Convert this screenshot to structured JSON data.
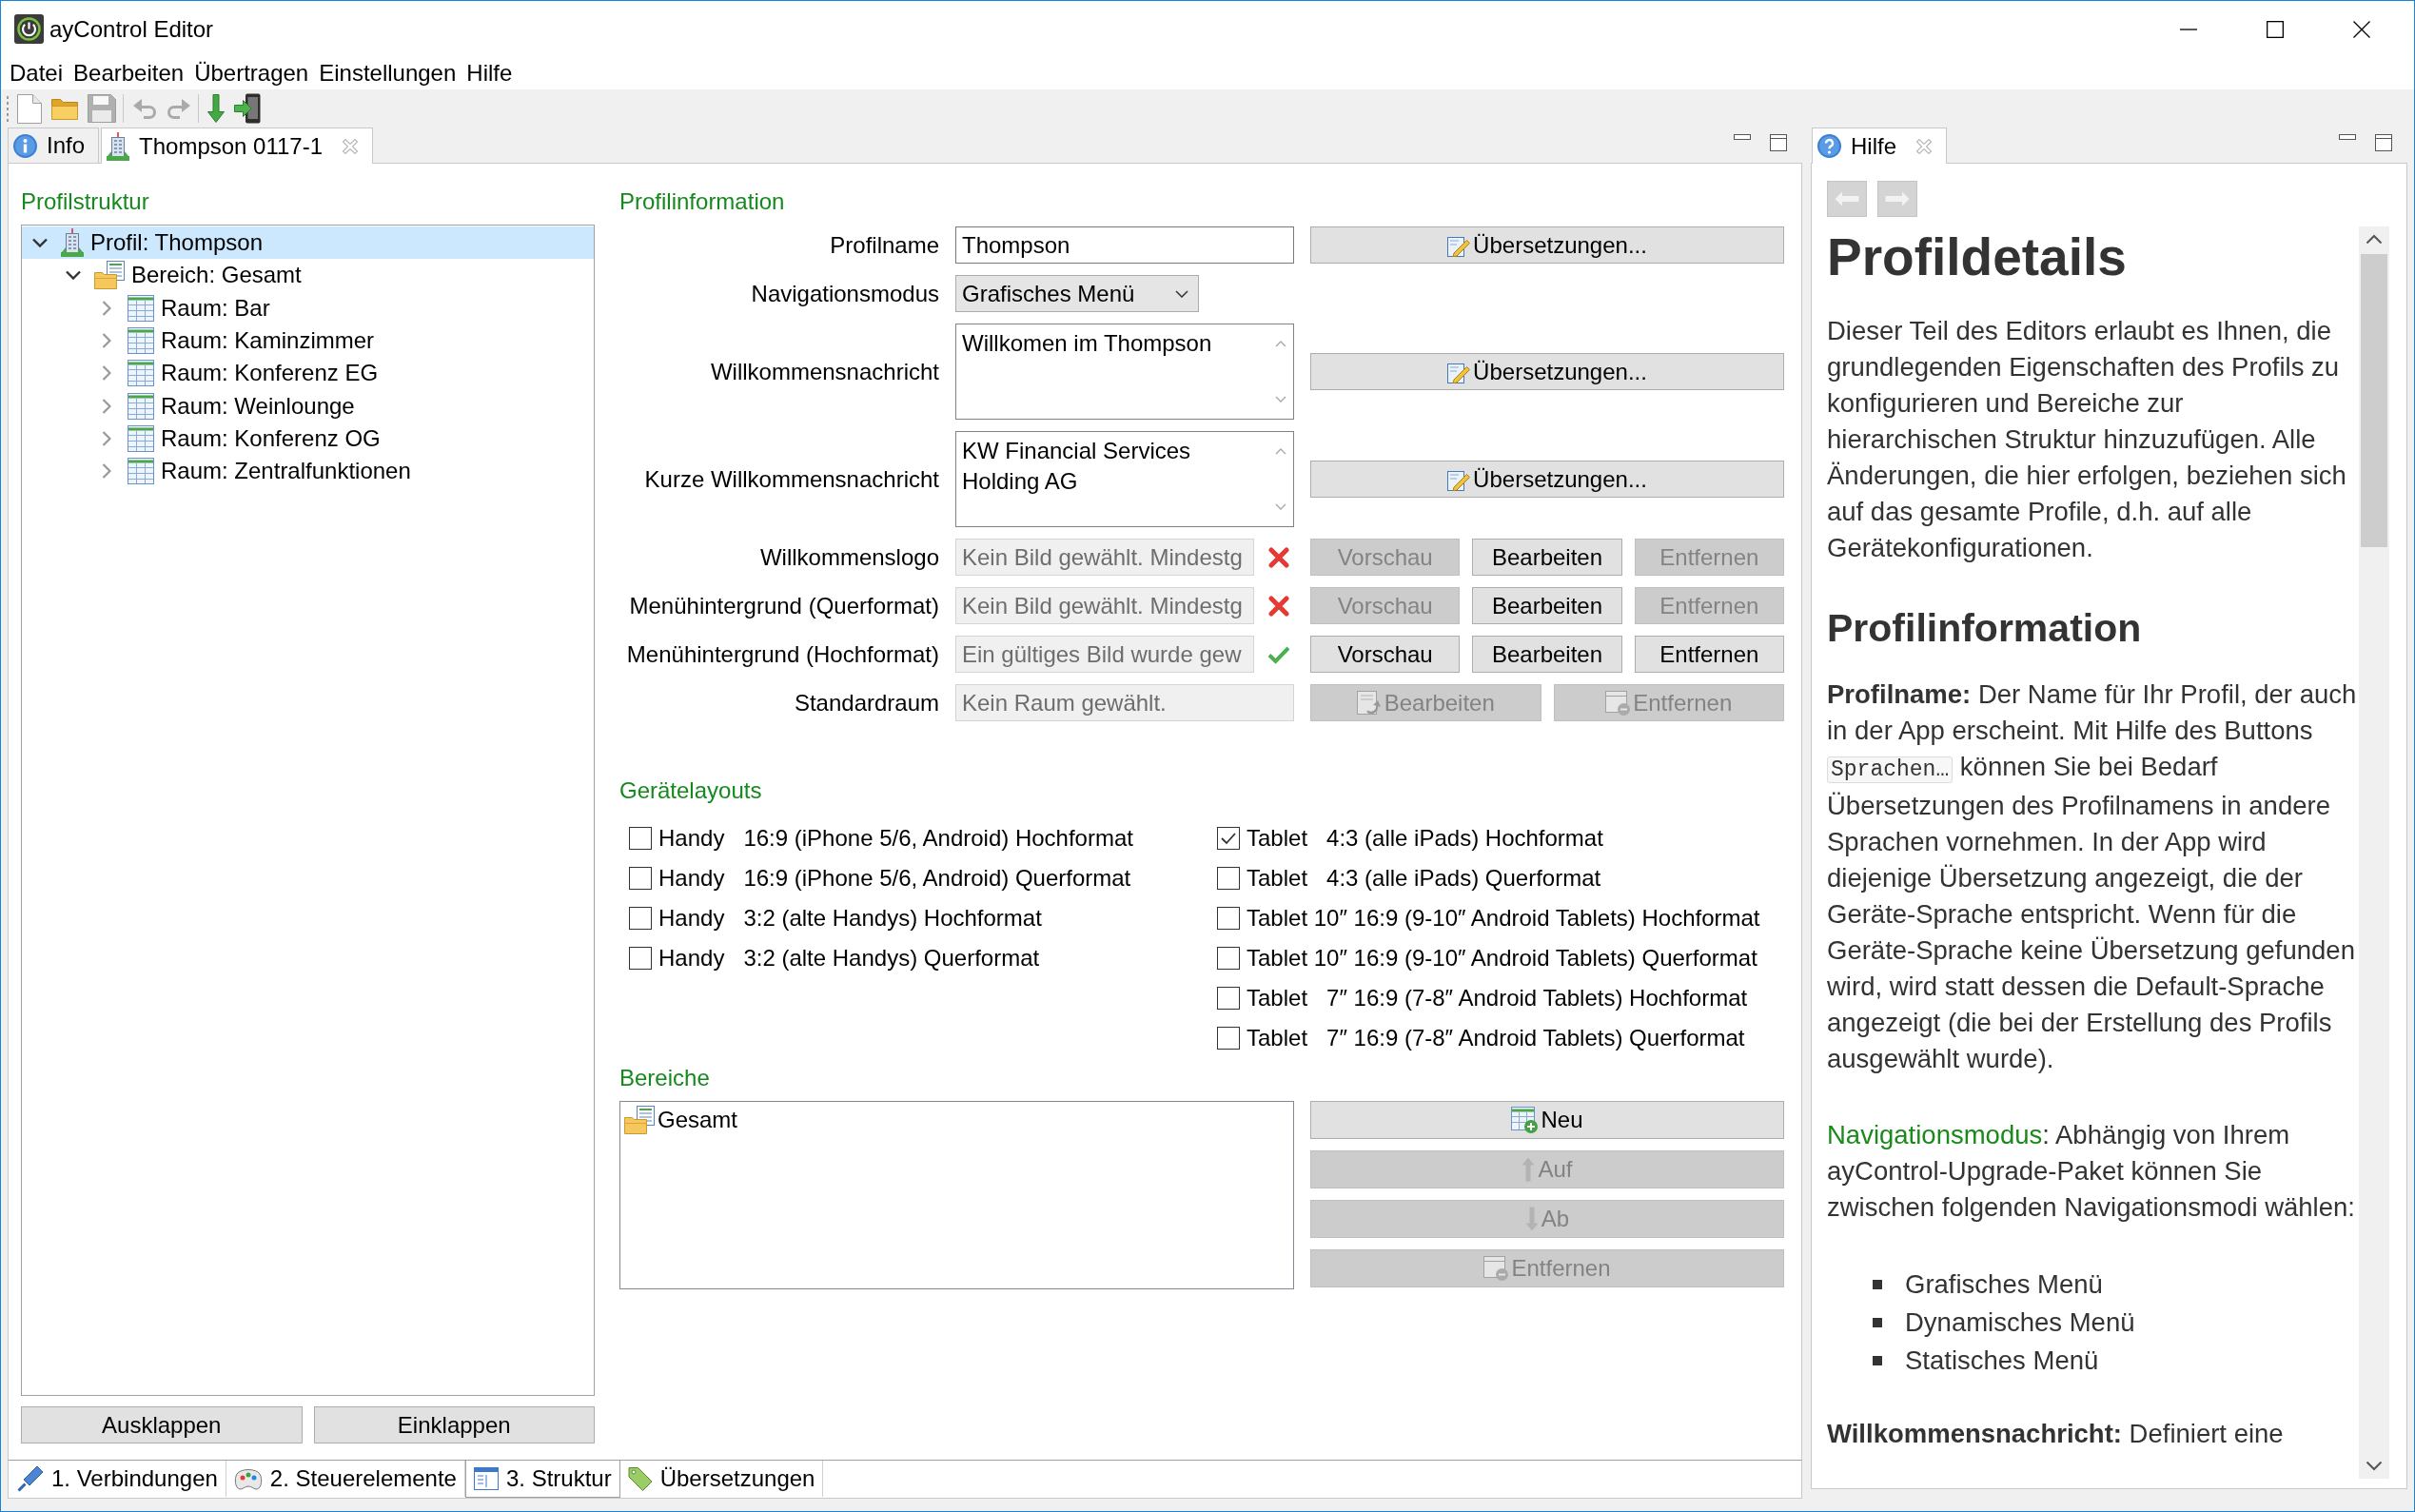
{
  "window": {
    "title": "ayControl Editor"
  },
  "menu": [
    "Datei",
    "Bearbeiten",
    "Übertragen",
    "Einstellungen",
    "Hilfe"
  ],
  "toolbar": [
    [
      {
        "kind": "new",
        "disabled": false
      },
      {
        "kind": "open",
        "disabled": false
      },
      {
        "kind": "save",
        "disabled": true
      }
    ],
    [
      {
        "kind": "undo",
        "disabled": true
      },
      {
        "kind": "redo",
        "disabled": true
      }
    ],
    [
      {
        "kind": "download",
        "disabled": false
      },
      {
        "kind": "exit",
        "disabled": false
      }
    ]
  ],
  "editor_tabs": [
    {
      "label": "Info",
      "kind": "info",
      "selected": false,
      "closable": false
    },
    {
      "label": "Thompson 0117-1",
      "kind": "profile",
      "selected": true,
      "closable": true
    }
  ],
  "structure": {
    "heading": "Profilstruktur",
    "tree": [
      {
        "label": "Profil: Thompson",
        "kind": "profile",
        "selected": true,
        "expanded": true,
        "children": [
          {
            "label": "Bereich: Gesamt",
            "kind": "area",
            "selected": false,
            "expanded": true,
            "children": [
              {
                "label": "Raum: Bar",
                "kind": "room",
                "selected": false,
                "expanded": false
              },
              {
                "label": "Raum: Kaminzimmer",
                "kind": "room",
                "selected": false,
                "expanded": false
              },
              {
                "label": "Raum: Konferenz EG",
                "kind": "room",
                "selected": false,
                "expanded": false
              },
              {
                "label": "Raum: Weinlounge",
                "kind": "room",
                "selected": false,
                "expanded": false
              },
              {
                "label": "Raum: Konferenz OG",
                "kind": "room",
                "selected": false,
                "expanded": false
              },
              {
                "label": "Raum: Zentralfunktionen",
                "kind": "room",
                "selected": false,
                "expanded": false
              }
            ]
          }
        ]
      }
    ],
    "buttons": [
      {
        "label": "Ausklappen",
        "disabled": false
      },
      {
        "label": "Einklappen",
        "disabled": false
      }
    ]
  },
  "profile_info": {
    "heading": "Profilinformation",
    "rows": [
      {
        "kind": "text",
        "label": "Profilname",
        "value": "Thompson",
        "buttons": [
          {
            "label": "Übersetzungen...",
            "kind": "translate",
            "disabled": false
          }
        ]
      },
      {
        "kind": "select",
        "label": "Navigationsmodus",
        "value": "Grafisches Menü"
      },
      {
        "kind": "textarea",
        "label": "Willkommensnachricht",
        "value": "Willkomen im Thompson",
        "buttons": [
          {
            "label": "Übersetzungen...",
            "kind": "translate",
            "disabled": false
          }
        ]
      },
      {
        "kind": "textarea",
        "label": "Kurze Willkommensnachricht",
        "value": "KW Financial Services Holding AG",
        "buttons": [
          {
            "label": "Übersetzungen...",
            "kind": "translate",
            "disabled": false
          }
        ]
      },
      {
        "kind": "image",
        "label": "Willkommenslogo",
        "value": "Kein Bild gewählt. Mindestg",
        "valid": false,
        "buttons": [
          {
            "label": "Vorschau",
            "disabled": true
          },
          {
            "label": "Bearbeiten",
            "disabled": false
          },
          {
            "label": "Entfernen",
            "disabled": true
          }
        ]
      },
      {
        "kind": "image",
        "label": "Menühintergrund (Querformat)",
        "value": "Kein Bild gewählt. Mindestg",
        "valid": false,
        "buttons": [
          {
            "label": "Vorschau",
            "disabled": true
          },
          {
            "label": "Bearbeiten",
            "disabled": false
          },
          {
            "label": "Entfernen",
            "disabled": true
          }
        ]
      },
      {
        "kind": "image",
        "label": "Menühintergrund (Hochformat)",
        "value": "Ein gültiges Bild wurde gew",
        "valid": true,
        "buttons": [
          {
            "label": "Vorschau",
            "disabled": false
          },
          {
            "label": "Bearbeiten",
            "disabled": false
          },
          {
            "label": "Entfernen",
            "disabled": false
          }
        ]
      },
      {
        "kind": "room",
        "label": "Standardraum",
        "value": "Kein Raum gewählt.",
        "buttons": [
          {
            "label": "Bearbeiten",
            "kind": "edit",
            "disabled": true
          },
          {
            "label": "Entfernen",
            "kind": "remove",
            "disabled": true
          }
        ]
      }
    ]
  },
  "device_layouts": {
    "heading": "Gerätelayouts",
    "columns": [
      [
        {
          "label": "Handy   16:9 (iPhone 5/6, Android) Hochformat",
          "checked": false
        },
        {
          "label": "Handy   16:9 (iPhone 5/6, Android) Querformat",
          "checked": false
        },
        {
          "label": "Handy   3:2 (alte Handys) Hochformat",
          "checked": false
        },
        {
          "label": "Handy   3:2 (alte Handys) Querformat",
          "checked": false
        }
      ],
      [
        {
          "label": "Tablet   4:3 (alle iPads) Hochformat",
          "checked": true
        },
        {
          "label": "Tablet   4:3 (alle iPads) Querformat",
          "checked": false
        },
        {
          "label": "Tablet 10″ 16:9 (9-10″ Android Tablets) Hochformat",
          "checked": false
        },
        {
          "label": "Tablet 10″ 16:9 (9-10″ Android Tablets) Querformat",
          "checked": false
        },
        {
          "label": "Tablet   7″ 16:9 (7-8″ Android Tablets) Hochformat",
          "checked": false
        },
        {
          "label": "Tablet   7″ 16:9 (7-8″ Android Tablets) Querformat",
          "checked": false
        }
      ]
    ]
  },
  "areas": {
    "heading": "Bereiche",
    "items": [
      {
        "label": "Gesamt",
        "selected": false
      }
    ],
    "buttons": [
      {
        "label": "Neu",
        "kind": "new",
        "disabled": false
      },
      {
        "label": "Auf",
        "kind": "up",
        "disabled": true
      },
      {
        "label": "Ab",
        "kind": "down",
        "disabled": true
      },
      {
        "label": "Entfernen",
        "kind": "remove",
        "disabled": true
      }
    ]
  },
  "bottom_tabs": [
    {
      "label": "1. Verbindungen",
      "kind": "connections",
      "selected": false
    },
    {
      "label": "2. Steuerelemente",
      "kind": "controls",
      "selected": false
    },
    {
      "label": "3. Struktur",
      "kind": "structure",
      "selected": true
    },
    {
      "label": "Übersetzungen",
      "kind": "translations",
      "selected": false
    }
  ],
  "help": {
    "tab": {
      "label": "Hilfe",
      "selected": true,
      "closable": true
    },
    "nav": [
      {
        "kind": "back",
        "disabled": true
      },
      {
        "kind": "forward",
        "disabled": true
      }
    ],
    "content": [
      {
        "kind": "h1",
        "text": "Profildetails"
      },
      {
        "kind": "p",
        "parts": [
          {
            "kind": "text",
            "text": "Dieser Teil des Editors erlaubt es Ihnen, die grundlegenden Eigenschaften des Profils zu konfigurieren und Bereiche zur hierarchischen Struktur hinzuzufügen. Alle Änderungen, die hier erfolgen, beziehen sich auf das gesamte Profile, d.h. auf alle Gerätekonfigurationen."
          }
        ]
      },
      {
        "kind": "h2",
        "text": "Profilinformation"
      },
      {
        "kind": "p",
        "parts": [
          {
            "kind": "text",
            "text": "**Profilname:** Der Name für Ihr Profil, der auch in der App erscheint. Mit Hilfe des Buttons "
          },
          {
            "kind": "code",
            "text": "Sprachen…"
          },
          {
            "kind": "text",
            "text": " können Sie bei Bedarf Übersetzungen des Profilnamens in andere Sprachen vornehmen. In der App wird diejenige Übersetzung angezeigt, die der Geräte-Sprache entspricht. Wenn für die Geräte-Sprache keine Übersetzung gefunden wird, wird statt dessen die Default-Sprache angezeigt (die bei der Erstellung des Profils ausgewählt wurde)."
          }
        ]
      },
      {
        "kind": "p",
        "parts": [
          {
            "kind": "term",
            "text": "Navigationsmodus"
          },
          {
            "kind": "text",
            "text": ": Abhängig von Ihrem ayControl-Upgrade-Paket können Sie zwischen folgenden Navigationsmodi wählen:"
          }
        ]
      },
      {
        "kind": "list",
        "items": [
          "Grafisches Menü",
          "Dynamisches Menü",
          "Statisches Menü"
        ]
      },
      {
        "kind": "p",
        "parts": [
          {
            "kind": "text",
            "text": "**Willkommensnachricht:** Definiert eine"
          }
        ]
      }
    ]
  }
}
